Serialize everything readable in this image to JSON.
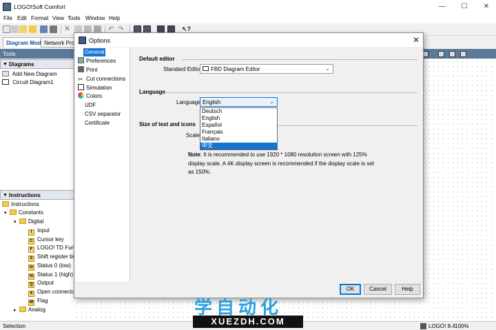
{
  "window": {
    "title": "LOGO!Soft Comfort",
    "minimize": "—",
    "maximize": "☐",
    "close": "✕"
  },
  "menu": [
    "File",
    "Edit",
    "Format",
    "View",
    "Tools",
    "Window",
    "Help"
  ],
  "mode_tabs": {
    "diagram_mode": "Diagram Mode",
    "network_project": "Network Proje"
  },
  "panels": {
    "tools": "Tools",
    "diagrams": {
      "header": "Diagrams",
      "items": [
        "Add New Diagram",
        "Circuit Diagram1"
      ]
    },
    "instructions": {
      "header": "Instructions",
      "tree": {
        "root": "Instructions",
        "constants": "Constants",
        "digital": "Digital",
        "digital_items": [
          {
            "badge": "I",
            "label": "Input"
          },
          {
            "badge": "C",
            "label": "Cursor key"
          },
          {
            "badge": "F",
            "label": "LOGO! TD Functi"
          },
          {
            "badge": "S",
            "label": "Shift register bit"
          },
          {
            "badge": "lo",
            "label": "Status 0 (low)"
          },
          {
            "badge": "hi",
            "label": "Status 1 (high)"
          },
          {
            "badge": "Q",
            "label": "Output"
          },
          {
            "badge": "X",
            "label": "Open connector"
          },
          {
            "badge": "M",
            "label": "Flag"
          }
        ],
        "analog": "Analog"
      }
    }
  },
  "status": {
    "left": "Selection",
    "product": "LOGO! 8.4",
    "zoom": "100%"
  },
  "dialog": {
    "title": "Options",
    "nav": [
      "General",
      "Preferences",
      "Print",
      "Cut connections",
      "Simulation",
      "Colors",
      "UDF",
      "CSV separator",
      "Certificate"
    ],
    "selected_nav": "General",
    "default_editor": {
      "section": "Default editor",
      "label": "Standard Editor:",
      "value": "FBD Diagram Editor"
    },
    "language": {
      "section": "Language",
      "label": "Language:",
      "value": "English",
      "options": [
        "Deutsch",
        "English",
        "Español",
        "Français",
        "Italiano",
        "中文"
      ],
      "highlighted": "中文"
    },
    "size": {
      "section": "Size of text and icons",
      "scale_label": "Scale",
      "note_bold": "Note",
      "note_text": ": It is recommended to use 1920 * 1080 resolution screen with 125% display scale. A 4K display screen is recommended if the display scale is set as 150%."
    },
    "buttons": {
      "ok": "OK",
      "cancel": "Cancel",
      "help": "Help"
    }
  },
  "watermark": {
    "cn": "学自动化",
    "en": "XUEZDH.COM"
  }
}
